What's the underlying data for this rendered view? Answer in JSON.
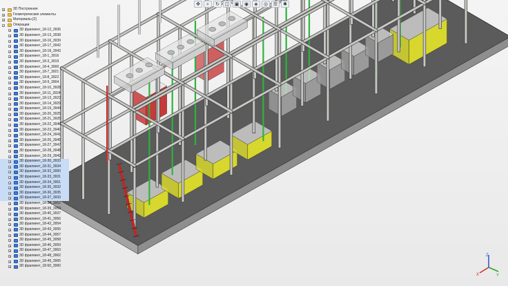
{
  "toolbar": {
    "icons": [
      "view-orient-icon",
      "zoom-icon",
      "rotate-icon",
      "section-icon",
      "display-icon",
      "render-icon",
      "material-icon",
      "camera-icon",
      "layers-icon",
      "lighting-icon"
    ]
  },
  "tree": {
    "top_items": [
      {
        "label": "3D Построения",
        "expanded": false
      },
      {
        "label": "Геометрические элементы",
        "expanded": false
      },
      {
        "label": "Материалы [2]",
        "expanded": false
      },
      {
        "label": "Операции",
        "expanded": true
      }
    ],
    "fragments": [
      "3D фрагмент_18-12_3936",
      "3D фрагмент_18-13_3938",
      "3D фрагмент_18-16_3939",
      "3D фрагмент_18-17_3942",
      "3D фрагмент_18-18_3943",
      "3D фрагмент_18-1_3916",
      "3D фрагмент_18-3_3919",
      "3D фрагмент_18-4_3900",
      "3D фрагмент_18-7_3921",
      "3D фрагмент_18-8_3922",
      "3D фрагмент_18-9_3904",
      "3D фрагмент_18-10_3928",
      "3D фрагмент_18-11_3924",
      "3D фрагмент_18-13_3923",
      "3D фрагмент_18-14_3929",
      "3D фрагмент_18-19_3944",
      "3D фрагмент_18-20_3925",
      "3D фрагмент_18-21_3926",
      "3D фрагмент_18-22_3946",
      "3D фрагмент_18-23_3940",
      "3D фрагмент_18-24_3941",
      "3D фрагмент_18-26_3945",
      "3D фрагмент_18-27_3947",
      "3D фрагмент_18-28_3948",
      "3D фрагмент_18-29_3949",
      "3D фрагмент_18-30_3933",
      "3D фрагмент_18-31_3934",
      "3D фрагмент_18-32_3950",
      "3D фрагмент_18-33_3931",
      "3D фрагмент_18-34_3951",
      "3D фрагмент_18-35_3932",
      "3D фрагмент_18-36_3935",
      "3D фрагмент_18-37_3933",
      "3D фрагмент_18-38_3952",
      "3D фрагмент_18-39_3953",
      "3D фрагмент_18-40_3937",
      "3D фрагмент_18-41_3956",
      "3D фрагмент_18-42_3954",
      "3D фрагмент_18-43_3955",
      "3D фрагмент_18-44_3957",
      "3D фрагмент_18-45_3958",
      "3D фрагмент_18-46_3959",
      "3D фрагмент_18-47_3963",
      "3D фрагмент_18-48_3962",
      "3D фрагмент_18-49_3965",
      "3D фрагмент_18-50_3960"
    ]
  },
  "triad": {
    "x": "X",
    "y": "Y",
    "z": "Z"
  },
  "colors": {
    "background": "#ececec",
    "slab": "#5b5b5b",
    "slab_side": "#8e8e8e",
    "frame": "#c7c7c4",
    "frame_dark": "#3c3c3c",
    "equipment_green": "#2db33e",
    "equipment_red": "#c73a3a",
    "equipment_yellow": "#d7d72e",
    "equipment_grey": "#9a9a9a",
    "tree_folder": "#e8c25a",
    "tree_part": "#3f7fd8"
  }
}
